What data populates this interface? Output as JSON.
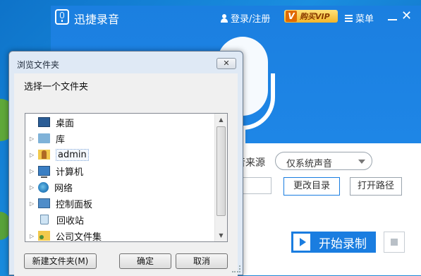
{
  "app": {
    "title": "迅捷录音",
    "login_label": "登录/注册",
    "vip_label": "购买VIP",
    "menu_label": "菜单",
    "close_glyph": "✕",
    "source_label": "声音来源",
    "source_value": "仅系统声音",
    "change_dir_label": "更改目录",
    "open_path_label": "打开路径",
    "start_label": "开始录制"
  },
  "dialog": {
    "title": "浏览文件夹",
    "close_glyph": "✕",
    "prompt": "选择一个文件夹",
    "tree": [
      {
        "label": "桌面",
        "icon": "desktop-icon",
        "expandable": false
      },
      {
        "label": "库",
        "icon": "library-folder-icon",
        "expandable": true
      },
      {
        "label": "admin",
        "icon": "user-folder-icon",
        "expandable": true,
        "selected": true
      },
      {
        "label": "计算机",
        "icon": "computer-icon",
        "expandable": true
      },
      {
        "label": "网络",
        "icon": "network-icon",
        "expandable": true
      },
      {
        "label": "控制面板",
        "icon": "control-panel-icon",
        "expandable": true
      },
      {
        "label": "回收站",
        "icon": "recycle-bin-icon",
        "expandable": false
      },
      {
        "label": "公司文件集",
        "icon": "shared-folder-icon",
        "expandable": true
      }
    ],
    "new_folder_label": "新建文件夹(M)",
    "ok_label": "确定",
    "cancel_label": "取消"
  },
  "colors": {
    "app_blue": "#1b7fe0",
    "start_button": "#1a7de0",
    "vip_gold": "#f3b52a"
  }
}
